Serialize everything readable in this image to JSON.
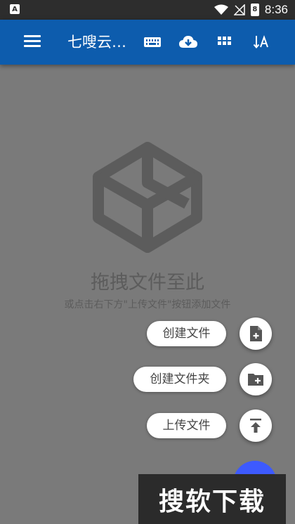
{
  "status_bar": {
    "app_badge": "A",
    "battery_level": "8",
    "time": "8:36"
  },
  "toolbar": {
    "title": "七嗖云…",
    "icons": [
      "menu-icon",
      "keyboard-icon",
      "cloud-download-icon",
      "grid-icon",
      "sort-icon"
    ]
  },
  "empty_state": {
    "title": "拖拽文件至此",
    "subtitle": "或点击右下方\"上传文件\"按钮添加文件"
  },
  "fab_menu": {
    "create_file_label": "创建文件",
    "create_folder_label": "创建文件夹",
    "upload_file_label": "上传文件"
  },
  "watermark": {
    "text": "搜软下载"
  },
  "colors": {
    "toolbar": "#0d5cad",
    "scrim": "#7a7a7a",
    "fab": "#3d5afe"
  }
}
